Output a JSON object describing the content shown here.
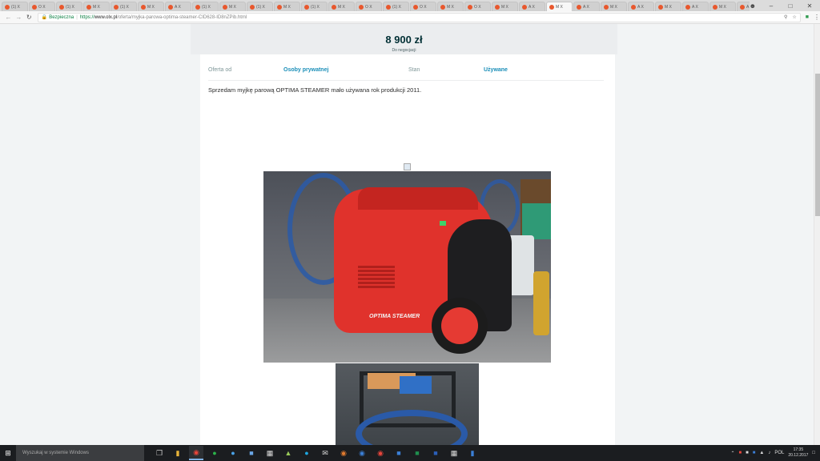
{
  "browser": {
    "tabs": [
      {
        "text": "(1) X"
      },
      {
        "text": "O X"
      },
      {
        "text": "(1) X"
      },
      {
        "text": "M X"
      },
      {
        "text": "(1) X"
      },
      {
        "text": "M X"
      },
      {
        "text": "A X"
      },
      {
        "text": "(1) X"
      },
      {
        "text": "M X"
      },
      {
        "text": "(1) X"
      },
      {
        "text": "M X"
      },
      {
        "text": "(1) X"
      },
      {
        "text": "M X"
      },
      {
        "text": "O X"
      },
      {
        "text": "(1) X"
      },
      {
        "text": "O X"
      },
      {
        "text": "M X"
      },
      {
        "text": "O X"
      },
      {
        "text": "M X"
      },
      {
        "text": "A X"
      },
      {
        "text": "M X"
      },
      {
        "text": "A X"
      },
      {
        "text": "M X"
      },
      {
        "text": "A X"
      },
      {
        "text": "M X"
      },
      {
        "text": "A X"
      },
      {
        "text": "M X"
      },
      {
        "text": "A X"
      },
      {
        "text": "M X"
      }
    ],
    "address": {
      "secure_label": "Bezpieczna",
      "scheme": "https://",
      "host": "www.olx.pl",
      "path": "/oferta/myjka-parowa-optima-steamer-CID628-ID8nZPib.html"
    }
  },
  "listing": {
    "price": "8 900 zł",
    "negotiable": "Do negocjacji",
    "details": [
      {
        "label": "Oferta od",
        "value": "Osoby prywatnej"
      },
      {
        "label": "Stan",
        "value": "Używane"
      }
    ],
    "description": "Sprzedam myjkę parową OPTIMA STEAMER mało używana rok produkcji 2011.",
    "photo1_badge": "OPTIMA STEAMER"
  },
  "taskbar": {
    "search_placeholder": "Wyszukaj w systemie Windows",
    "language": "POL",
    "time": "17:35",
    "date": "20.12.2017"
  }
}
